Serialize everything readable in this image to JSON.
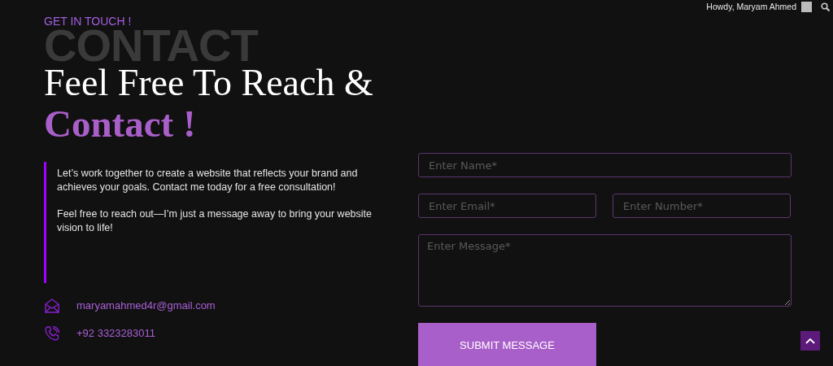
{
  "admin_bar": {
    "greeting": "Howdy, Maryam Ahmed"
  },
  "section": {
    "eyebrow": "GET IN TOUCH !",
    "backdrop_word": "CONTACT",
    "heading": "Feel Free To Reach &",
    "heading_accent": "Contact !"
  },
  "intro": [
    "Let’s work together to create a website that reflects your brand and achieves your goals. Contact me today for a free consultation!",
    "Feel free to reach out—I’m just a message away to bring your website vision to life!"
  ],
  "contacts": [
    {
      "kind": "email",
      "text": "maryamahmed4r@gmail.com"
    },
    {
      "kind": "phone",
      "text": "+92 3323283011"
    }
  ],
  "form": {
    "rows": [
      [
        {
          "kind": "text",
          "placeholder": "Enter Name*"
        }
      ],
      [
        {
          "kind": "text",
          "placeholder": "Enter Email*"
        },
        {
          "kind": "text",
          "placeholder": "Enter Number*"
        }
      ],
      [
        {
          "kind": "textarea",
          "placeholder": "Enter Message*"
        }
      ]
    ],
    "submit": "SUBMIT MESSAGE"
  }
}
